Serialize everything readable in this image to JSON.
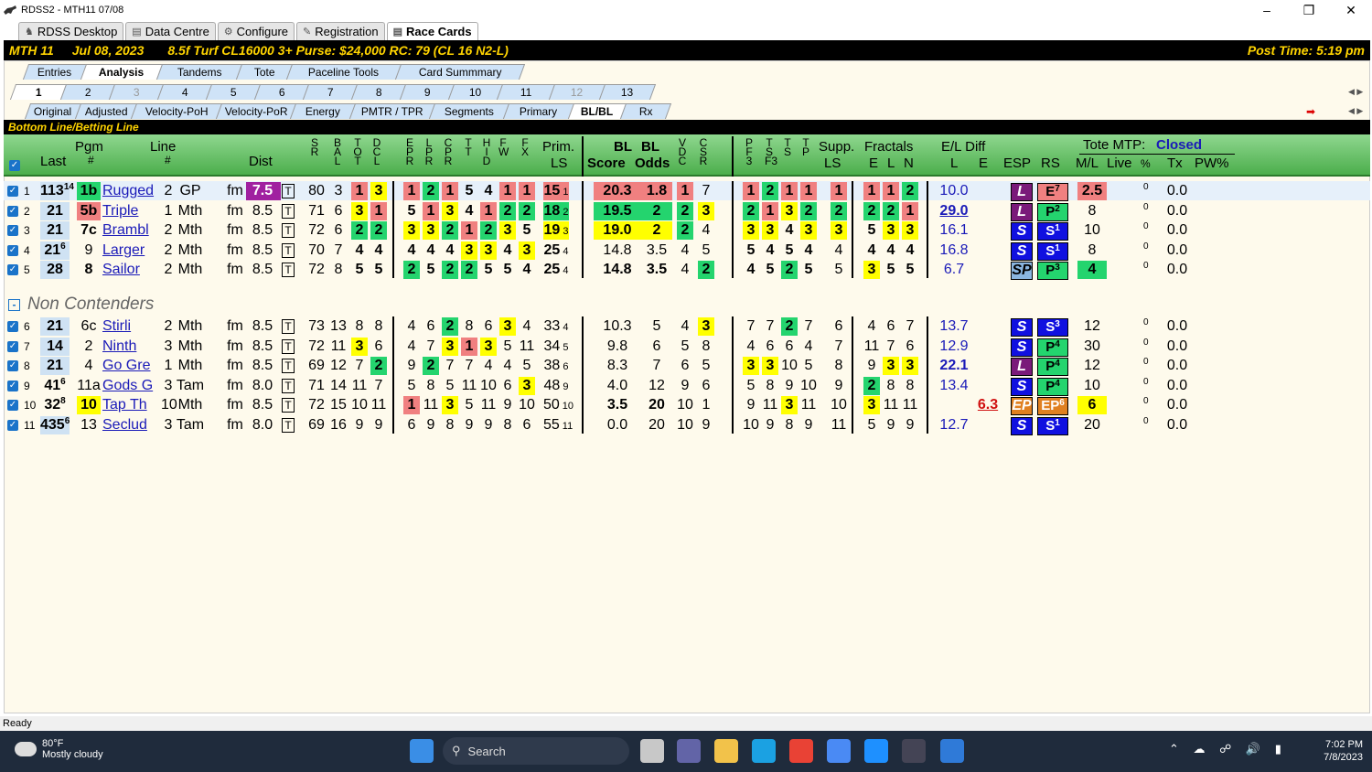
{
  "window": {
    "title": "RDSS2 - MTH11  07/08"
  },
  "main_tabs": [
    {
      "label": "RDSS Desktop",
      "icon": "horse-icon"
    },
    {
      "label": "Data Centre",
      "icon": "database-icon"
    },
    {
      "label": "Configure",
      "icon": "gear-icon"
    },
    {
      "label": "Registration",
      "icon": "registration-icon"
    },
    {
      "label": "Race Cards",
      "icon": "card-icon",
      "active": true
    }
  ],
  "race_header": {
    "track": "MTH  11",
    "date": "Jul 08, 2023",
    "conditions": "8.5f  Turf  CL16000  3+  Purse: $24,000  RC: 79  (CL 16 N2-L)",
    "post_time": "Post Time: 5:19 pm"
  },
  "view_tabs": [
    "Entries",
    "Analysis",
    "Tandems",
    "Tote",
    "Paceline Tools",
    "Card Summmary"
  ],
  "view_tab_active": "Analysis",
  "race_tabs": [
    "1",
    "2",
    "3",
    "4",
    "5",
    "6",
    "7",
    "8",
    "9",
    "10",
    "11",
    "12",
    "13"
  ],
  "race_tab_active": "1",
  "race_tabs_dim": [
    "3",
    "12"
  ],
  "sub_tabs": [
    "Original",
    "Adjusted",
    "Velocity-PoH",
    "Velocity-PoR",
    "Energy",
    "PMTR / TPR",
    "Segments",
    "Primary",
    "BL/BL",
    "Rx"
  ],
  "sub_tab_active": "BL/BL",
  "section_title": "Bottom Line/Betting Line",
  "headers": {
    "last": "Last",
    "pgm": "Pgm",
    "pgm_num": "#",
    "line": "Line",
    "line_num": "#",
    "dist": "Dist",
    "sr": [
      "S",
      "R"
    ],
    "bal": [
      "B",
      "A",
      "L"
    ],
    "tot": [
      "T",
      "O",
      "T"
    ],
    "dcl": [
      "D",
      "C",
      "L"
    ],
    "epr": [
      "E",
      "P",
      "R"
    ],
    "lpr": [
      "L",
      "P",
      "R"
    ],
    "cpr": [
      "C",
      "P",
      "R"
    ],
    "tt": [
      "T",
      "T"
    ],
    "hid": [
      "H",
      "I",
      "D"
    ],
    "fw": [
      "F",
      "W"
    ],
    "fx": [
      "F",
      "X"
    ],
    "prim_ls": [
      "Prim.",
      "LS"
    ],
    "bl_score": [
      "BL",
      "Score"
    ],
    "bl_odds": [
      "BL",
      "Odds"
    ],
    "vdc": [
      "V",
      "D",
      "C"
    ],
    "csr": [
      "C",
      "S",
      "R"
    ],
    "pf3": [
      "P",
      "F",
      "3"
    ],
    "tsf3": [
      "T",
      "S",
      "F3"
    ],
    "ts": [
      "T",
      "S"
    ],
    "tp": [
      "T",
      "P"
    ],
    "supp_ls": [
      "Supp.",
      "LS"
    ],
    "fractals": "Fractals",
    "frac_sub": [
      "E",
      "L",
      "N"
    ],
    "el_diff": "E/L Diff",
    "el_sub": [
      "L",
      "E"
    ],
    "esp": "ESP",
    "rs": "RS",
    "tote_mtp": "Tote MTP:",
    "tote_status": "Closed",
    "ml": "M/L",
    "live": "Live",
    "pct": "%",
    "tx": "Tx",
    "pw": "PW%"
  },
  "contenders": [
    {
      "n": "1",
      "last": "113",
      "last_sup": "14",
      "pgm": "1b",
      "name": "Rugged",
      "line": "2",
      "trk": "GP",
      "surf": "fm",
      "dist": "7.5",
      "sr": "80",
      "bal": "3",
      "tot": "1",
      "dcl": "3",
      "epr": "1",
      "lpr": "2",
      "cpr": "1",
      "tt": "5",
      "hid": "4",
      "fw": "1",
      "fx": "1",
      "pls": "15",
      "pls_sub": "1",
      "score": "20.3",
      "odds": "1.8",
      "vdc": "1",
      "csr": "7",
      "pf3": "1",
      "tsf3": "2",
      "ts": "1",
      "tp": "1",
      "supp": "1",
      "fe": "1",
      "fl": "1",
      "fn": "2",
      "el_l": "10.0",
      "el_e": "",
      "esp": "L",
      "rs": "E",
      "rs_sup": "7",
      "ml": "2.5",
      "live": "0",
      "tx": "0.0"
    },
    {
      "n": "2",
      "last": "21",
      "last_sup": "",
      "pgm": "5b",
      "name": "Triple",
      "line": "1",
      "trk": "Mth",
      "surf": "fm",
      "dist": "8.5",
      "sr": "71",
      "bal": "6",
      "tot": "3",
      "dcl": "1",
      "epr": "5",
      "lpr": "1",
      "cpr": "3",
      "tt": "4",
      "hid": "1",
      "fw": "2",
      "fx": "2",
      "pls": "18",
      "pls_sub": "2",
      "score": "19.5",
      "odds": "2",
      "vdc": "2",
      "csr": "3",
      "pf3": "2",
      "tsf3": "1",
      "ts": "3",
      "tp": "2",
      "supp": "2",
      "fe": "2",
      "fl": "2",
      "fn": "1",
      "el_l": "29.0",
      "el_e": "",
      "esp": "L",
      "rs": "P",
      "rs_sup": "2",
      "ml": "8",
      "live": "0",
      "tx": "0.0"
    },
    {
      "n": "3",
      "last": "21",
      "last_sup": "",
      "pgm": "7c",
      "name": "Brambl",
      "line": "2",
      "trk": "Mth",
      "surf": "fm",
      "dist": "8.5",
      "sr": "72",
      "bal": "6",
      "tot": "2",
      "dcl": "2",
      "epr": "3",
      "lpr": "3",
      "cpr": "2",
      "tt": "1",
      "hid": "2",
      "fw": "3",
      "fx": "5",
      "pls": "19",
      "pls_sub": "3",
      "score": "19.0",
      "odds": "2",
      "vdc": "2",
      "csr": "4",
      "pf3": "3",
      "tsf3": "3",
      "ts": "4",
      "tp": "3",
      "supp": "3",
      "fe": "5",
      "fl": "3",
      "fn": "3",
      "el_l": "16.1",
      "el_e": "",
      "esp": "S",
      "rs": "S",
      "rs_sup": "1",
      "ml": "10",
      "live": "0",
      "tx": "0.0"
    },
    {
      "n": "4",
      "last": "21",
      "last_sup": "6",
      "pgm": "9",
      "name": "Larger",
      "line": "2",
      "trk": "Mth",
      "surf": "fm",
      "dist": "8.5",
      "sr": "70",
      "bal": "7",
      "tot": "4",
      "dcl": "4",
      "epr": "4",
      "lpr": "4",
      "cpr": "4",
      "tt": "3",
      "hid": "3",
      "fw": "4",
      "fx": "3",
      "pls": "25",
      "pls_sub": "4",
      "score": "14.8",
      "odds": "3.5",
      "vdc": "4",
      "csr": "5",
      "pf3": "5",
      "tsf3": "4",
      "ts": "5",
      "tp": "4",
      "supp": "4",
      "fe": "4",
      "fl": "4",
      "fn": "4",
      "el_l": "16.8",
      "el_e": "",
      "esp": "S",
      "rs": "S",
      "rs_sup": "1",
      "ml": "8",
      "live": "0",
      "tx": "0.0"
    },
    {
      "n": "5",
      "last": "28",
      "last_sup": "",
      "pgm": "8",
      "name": "Sailor",
      "line": "2",
      "trk": "Mth",
      "surf": "fm",
      "dist": "8.5",
      "sr": "72",
      "bal": "8",
      "tot": "5",
      "dcl": "5",
      "epr": "2",
      "lpr": "5",
      "cpr": "2",
      "tt": "2",
      "hid": "5",
      "fw": "5",
      "fx": "4",
      "pls": "25",
      "pls_sub": "4",
      "score": "14.8",
      "odds": "3.5",
      "vdc": "4",
      "csr": "2",
      "pf3": "4",
      "tsf3": "5",
      "ts": "2",
      "tp": "5",
      "supp": "5",
      "fe": "3",
      "fl": "5",
      "fn": "5",
      "el_l": "6.7",
      "el_e": "",
      "esp": "SP",
      "rs": "P",
      "rs_sup": "3",
      "ml": "4",
      "live": "0",
      "tx": "0.0"
    }
  ],
  "non_contenders_label": "Non Contenders",
  "non_contenders_toggle": "-",
  "non_contenders": [
    {
      "n": "6",
      "last": "21",
      "last_sup": "",
      "pgm": "6c",
      "name": "Stirli",
      "line": "2",
      "trk": "Mth",
      "surf": "fm",
      "dist": "8.5",
      "sr": "73",
      "bal": "13",
      "tot": "8",
      "dcl": "8",
      "epr": "4",
      "lpr": "6",
      "cpr": "2",
      "tt": "8",
      "hid": "6",
      "fw": "3",
      "fx": "4",
      "pls": "33",
      "pls_sub": "4",
      "score": "10.3",
      "odds": "5",
      "vdc": "4",
      "csr": "3",
      "pf3": "7",
      "tsf3": "7",
      "ts": "2",
      "tp": "7",
      "supp": "6",
      "fe": "4",
      "fl": "6",
      "fn": "7",
      "el_l": "13.7",
      "el_e": "",
      "esp": "S",
      "rs": "S",
      "rs_sup": "3",
      "ml": "12",
      "live": "0",
      "tx": "0.0"
    },
    {
      "n": "7",
      "last": "14",
      "last_sup": "",
      "pgm": "2",
      "name": "Ninth",
      "line": "3",
      "trk": "Mth",
      "surf": "fm",
      "dist": "8.5",
      "sr": "72",
      "bal": "11",
      "tot": "3",
      "dcl": "6",
      "epr": "4",
      "lpr": "7",
      "cpr": "3",
      "tt": "1",
      "hid": "3",
      "fw": "5",
      "fx": "11",
      "pls": "34",
      "pls_sub": "5",
      "score": "9.8",
      "odds": "6",
      "vdc": "5",
      "csr": "8",
      "pf3": "4",
      "tsf3": "6",
      "ts": "6",
      "tp": "4",
      "supp": "7",
      "fe": "11",
      "fl": "7",
      "fn": "6",
      "el_l": "12.9",
      "el_e": "",
      "esp": "S",
      "rs": "P",
      "rs_sup": "4",
      "ml": "30",
      "live": "0",
      "tx": "0.0"
    },
    {
      "n": "8",
      "last": "21",
      "last_sup": "",
      "pgm": "4",
      "name": "Go Gre",
      "line": "1",
      "trk": "Mth",
      "surf": "fm",
      "dist": "8.5",
      "sr": "69",
      "bal": "12",
      "tot": "7",
      "dcl": "2",
      "epr": "9",
      "lpr": "2",
      "cpr": "7",
      "tt": "7",
      "hid": "4",
      "fw": "4",
      "fx": "5",
      "pls": "38",
      "pls_sub": "6",
      "score": "8.3",
      "odds": "7",
      "vdc": "6",
      "csr": "5",
      "pf3": "3",
      "tsf3": "3",
      "ts": "10",
      "tp": "5",
      "supp": "8",
      "fe": "9",
      "fl": "3",
      "fn": "3",
      "el_l": "22.1",
      "el_e": "",
      "esp": "L",
      "rs": "P",
      "rs_sup": "4",
      "ml": "12",
      "live": "0",
      "tx": "0.0"
    },
    {
      "n": "9",
      "last": "41",
      "last_sup": "6",
      "pgm": "11a",
      "name": "Gods G",
      "line": "3",
      "trk": "Tam",
      "surf": "fm",
      "dist": "8.0",
      "sr": "71",
      "bal": "14",
      "tot": "11",
      "dcl": "7",
      "epr": "5",
      "lpr": "8",
      "cpr": "5",
      "tt": "11",
      "hid": "10",
      "fw": "6",
      "fx": "3",
      "pls": "48",
      "pls_sub": "9",
      "score": "4.0",
      "odds": "12",
      "vdc": "9",
      "csr": "6",
      "pf3": "5",
      "tsf3": "8",
      "ts": "9",
      "tp": "10",
      "supp": "9",
      "fe": "2",
      "fl": "8",
      "fn": "8",
      "el_l": "13.4",
      "el_e": "",
      "esp": "S",
      "rs": "P",
      "rs_sup": "4",
      "ml": "10",
      "live": "0",
      "tx": "0.0"
    },
    {
      "n": "10",
      "last": "32",
      "last_sup": "8",
      "pgm": "10",
      "name": "Tap Th",
      "line": "10",
      "trk": "Mth",
      "surf": "fm",
      "dist": "8.5",
      "sr": "72",
      "bal": "15",
      "tot": "10",
      "dcl": "11",
      "epr": "1",
      "lpr": "11",
      "cpr": "3",
      "tt": "5",
      "hid": "11",
      "fw": "9",
      "fx": "10",
      "pls": "50",
      "pls_sub": "10",
      "score": "3.5",
      "odds": "20",
      "vdc": "10",
      "csr": "1",
      "pf3": "9",
      "tsf3": "11",
      "ts": "3",
      "tp": "11",
      "supp": "10",
      "fe": "3",
      "fl": "11",
      "fn": "11",
      "el_l": "",
      "el_e": "6.3",
      "esp": "EP",
      "rs": "EP",
      "rs_sup": "6",
      "ml": "6",
      "live": "0",
      "tx": "0.0"
    },
    {
      "n": "11",
      "last": "435",
      "last_sup": "6",
      "pgm": "13",
      "name": "Seclud",
      "line": "3",
      "trk": "Tam",
      "surf": "fm",
      "dist": "8.0",
      "sr": "69",
      "bal": "16",
      "tot": "9",
      "dcl": "9",
      "epr": "6",
      "lpr": "9",
      "cpr": "8",
      "tt": "9",
      "hid": "9",
      "fw": "8",
      "fx": "6",
      "pls": "55",
      "pls_sub": "11",
      "score": "0.0",
      "odds": "20",
      "vdc": "10",
      "csr": "9",
      "pf3": "10",
      "tsf3": "9",
      "ts": "8",
      "tp": "9",
      "supp": "11",
      "fe": "5",
      "fl": "9",
      "fn": "9",
      "el_l": "12.7",
      "el_e": "",
      "esp": "S",
      "rs": "S",
      "rs_sup": "1",
      "ml": "20",
      "live": "0",
      "tx": "0.0"
    }
  ],
  "status": "Ready",
  "taskbar": {
    "weather_temp": "80°F",
    "weather_desc": "Mostly cloudy",
    "search_placeholder": "Search",
    "time": "7:02 PM",
    "date": "7/8/2023"
  },
  "colors": {
    "header_green": "#4cae4c",
    "race_bar": "#000000",
    "race_text": "#ffd400",
    "highlight_yellow": "#ffff00",
    "highlight_green": "#24d46e",
    "highlight_red": "#f08080",
    "link_blue": "#1a1ab8"
  }
}
